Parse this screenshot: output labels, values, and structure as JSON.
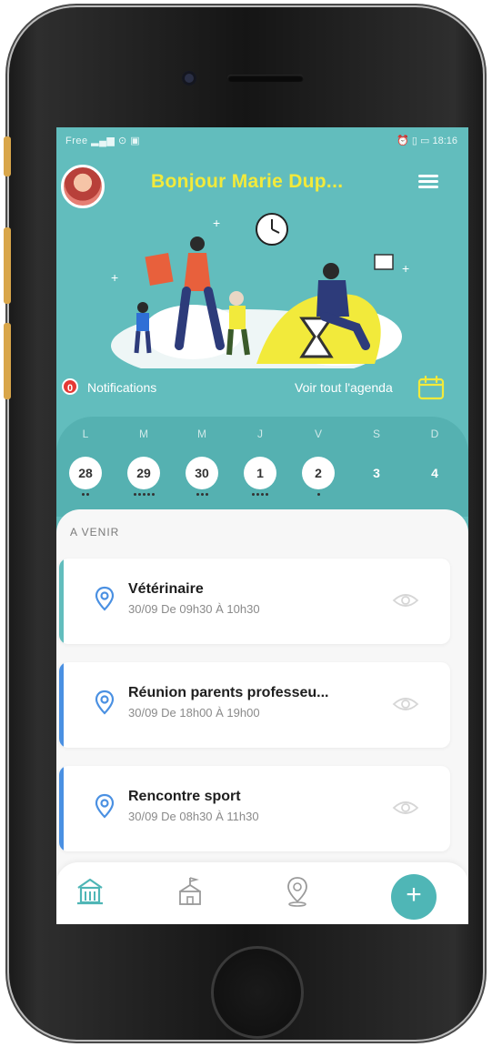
{
  "status_bar": {
    "left": "Free ▂▄▆ ⊙ ▣",
    "right": "⏰ ▯ ▭ 18:16"
  },
  "header": {
    "greeting": "Bonjour Marie Dup..."
  },
  "notifications": {
    "count": "0",
    "label": "Notifications"
  },
  "agenda": {
    "link_label": "Voir tout l'agenda"
  },
  "week": {
    "days": [
      {
        "letter": "L",
        "number": "28",
        "dots": 2,
        "filled": true
      },
      {
        "letter": "M",
        "number": "29",
        "dots": 5,
        "filled": true
      },
      {
        "letter": "M",
        "number": "30",
        "dots": 3,
        "filled": true
      },
      {
        "letter": "J",
        "number": "1",
        "dots": 4,
        "filled": true
      },
      {
        "letter": "V",
        "number": "2",
        "dots": 1,
        "filled": true
      },
      {
        "letter": "S",
        "number": "3",
        "dots": 0,
        "filled": false
      },
      {
        "letter": "D",
        "number": "4",
        "dots": 0,
        "filled": false
      }
    ]
  },
  "upcoming": {
    "section_label": "A VENIR",
    "events": [
      {
        "title": "Vétérinaire",
        "time": "30/09 De 09h30 À 10h30",
        "accent": "#62bdbd"
      },
      {
        "title": "Réunion parents professeu...",
        "time": "30/09 De 18h00 À 19h00",
        "accent": "#4a90e2"
      },
      {
        "title": "Rencontre sport",
        "time": "30/09 De 08h30 À 11h30",
        "accent": "#4a90e2"
      }
    ]
  },
  "tabbar": {
    "fab_label": "+"
  },
  "colors": {
    "primary": "#62bdbd",
    "greeting": "#f2ea3b",
    "notif_badge": "#e53935",
    "blue_accent": "#4a90e2"
  }
}
